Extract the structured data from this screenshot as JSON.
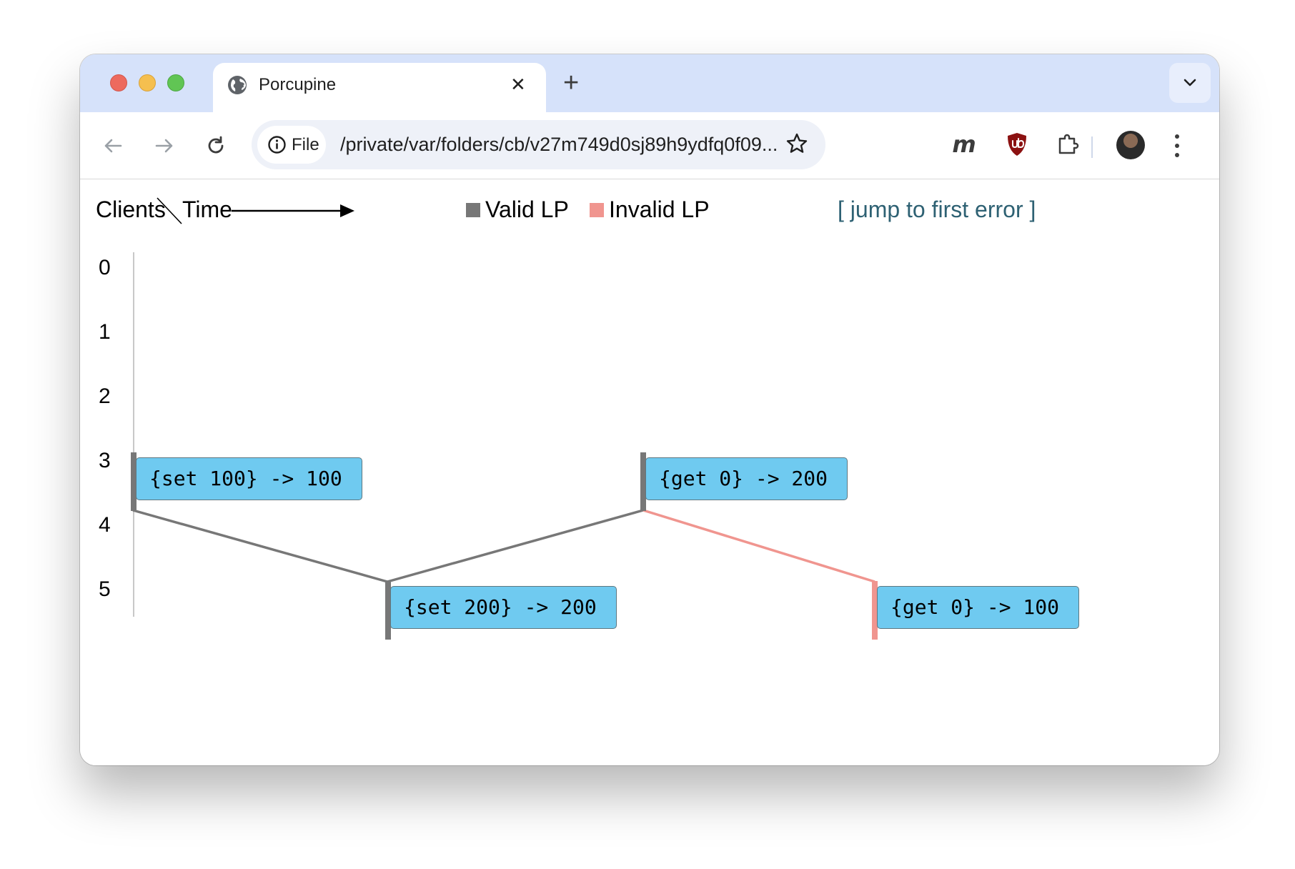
{
  "browser": {
    "tab_title": "Porcupine",
    "tab_close": "✕",
    "new_tab": "+",
    "omnibox": {
      "chip_label": "File",
      "url": "/private/var/folders/cb/v27m749d0sj89h9ydfq0f09..."
    },
    "extensions": {
      "m_label": "m"
    }
  },
  "header": {
    "clients": "Clients",
    "time": "Time",
    "valid_lp": "Valid LP",
    "invalid_lp": "Invalid LP",
    "jump": "[ jump to first error ]"
  },
  "colors": {
    "valid": "#777777",
    "invalid": "#f0958f",
    "op_fill": "#6fcaf0",
    "link": "#2e6173"
  },
  "clients": [
    "0",
    "1",
    "2",
    "3",
    "4",
    "5"
  ],
  "operations": [
    {
      "client": "3",
      "label": "{set 100} -> 100"
    },
    {
      "client": "3",
      "label": "{get 0} -> 200"
    },
    {
      "client": "5",
      "label": "{set 200} -> 200"
    },
    {
      "client": "5",
      "label": "{get 0} -> 100"
    }
  ]
}
